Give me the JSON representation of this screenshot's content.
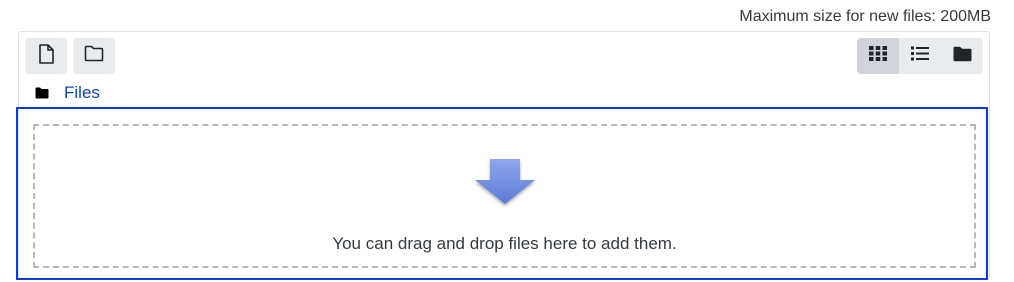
{
  "filemanager": {
    "max_size_text": "Maximum size for new files: 200MB",
    "toolbar": {
      "add_file_icon": "file-icon",
      "create_folder_icon": "folder-outline-icon",
      "views": [
        {
          "icon": "grid-icon",
          "active": true
        },
        {
          "icon": "list-icon",
          "active": false
        },
        {
          "icon": "folder-icon",
          "active": false
        }
      ]
    },
    "path": {
      "folder_icon": "folder-icon",
      "label": "Files"
    },
    "dropzone": {
      "arrow_icon": "down-arrow-icon",
      "message": "You can drag and drop files here to add them."
    },
    "colors": {
      "link": "#0f47ad",
      "dropzone_border": "#0f3bdc",
      "dashed_border": "#b8b8b8",
      "arrow": "#6f8fe0",
      "button_bg": "#e9ecef",
      "button_active_bg": "#ced4da"
    }
  }
}
